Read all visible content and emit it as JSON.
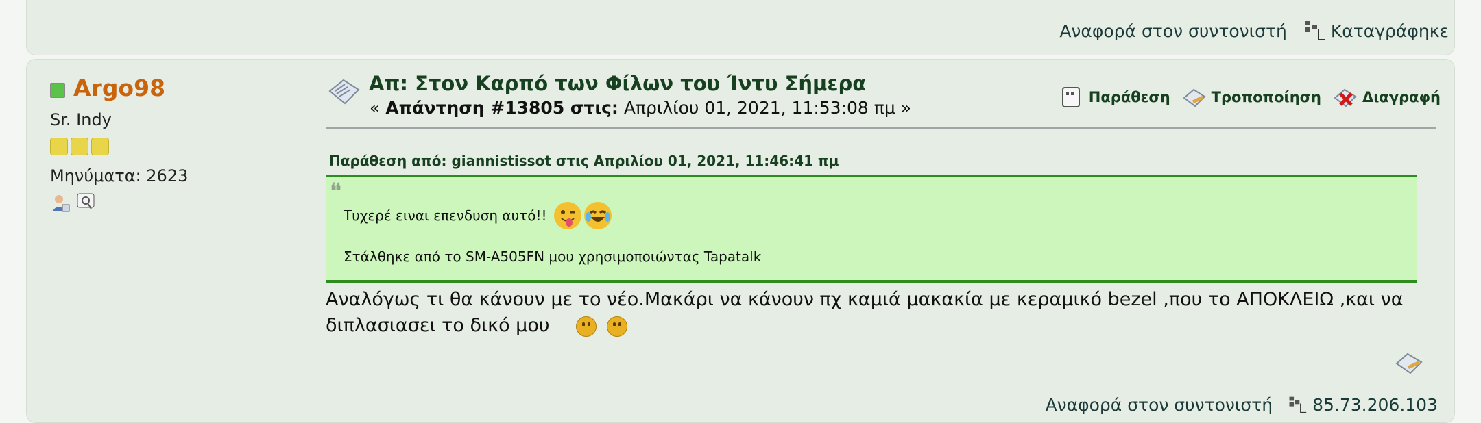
{
  "previous_post": {
    "report_label": "Αναφορά στον συντονιστή",
    "logged_label": "Καταγράφηκε"
  },
  "post": {
    "author": {
      "username": "Argo98",
      "rank": "Sr. Indy",
      "stars": 3,
      "post_count_label": "Μηνύματα: 2623"
    },
    "subject": "Απ: Στον Καρπό των Φίλων του Ίντυ Σήμερα",
    "reply_prefix": "« ",
    "reply_label": "Απάντηση #13805 στις:",
    "reply_date": " Απριλίου 01, 2021, 11:53:08 πμ »",
    "actions": {
      "quote": "Παράθεση",
      "modify": "Τροποποίηση",
      "delete": "Διαγραφή"
    },
    "quote": {
      "header": "Παράθεση από: giannistissot στις Απριλίου 01, 2021, 11:46:41 πμ",
      "line1": "Τυχερέ ειναι επενδυση αυτό!!",
      "line2": "Στάλθηκε από το SM-A505FN μου χρησιμοποιώντας Tapatalk"
    },
    "body": "Αναλόγως τι θα κάνουν με το νέο.Μακάρι να κάνουν πχ  καμιά μακακία με κεραμικό bezel ,που το ΑΠΟΚΛΕΙΩ ,και να διπλασιασει το δικό μου",
    "footer": {
      "report_label": "Αναφορά στον συντονιστή",
      "ip": "85.73.206.103"
    }
  },
  "colors": {
    "username": "#c9640c",
    "subject": "#16401f",
    "quote_bg": "#ccf6bb",
    "quote_border": "#2e8b1e",
    "post_bg": "#e6ede4"
  }
}
